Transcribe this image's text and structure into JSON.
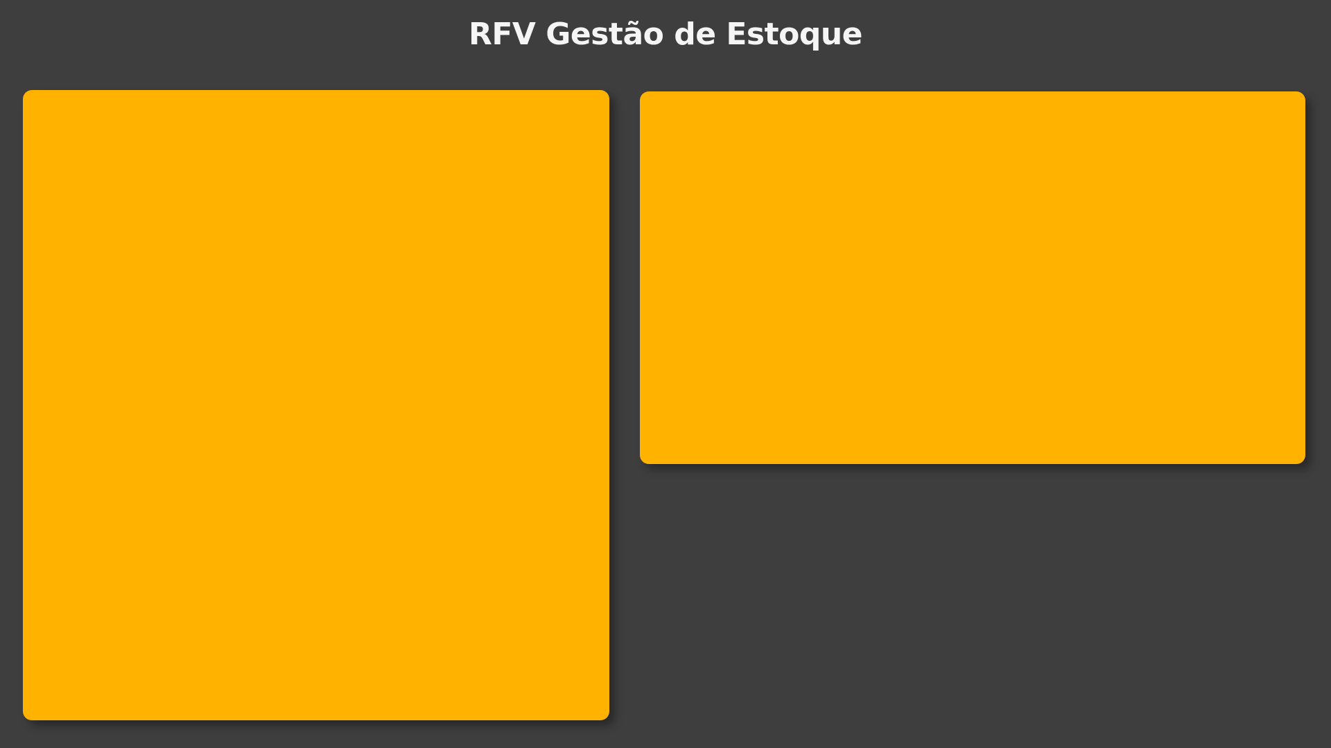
{
  "page": {
    "title": "RFV Gestão de Estoque"
  },
  "colors": {
    "background": "#3e3e3e",
    "title_text": "#f5f5f5",
    "card_fill": "#ffb300"
  },
  "panels": [
    {
      "name": "left-panel"
    },
    {
      "name": "right-panel"
    }
  ]
}
